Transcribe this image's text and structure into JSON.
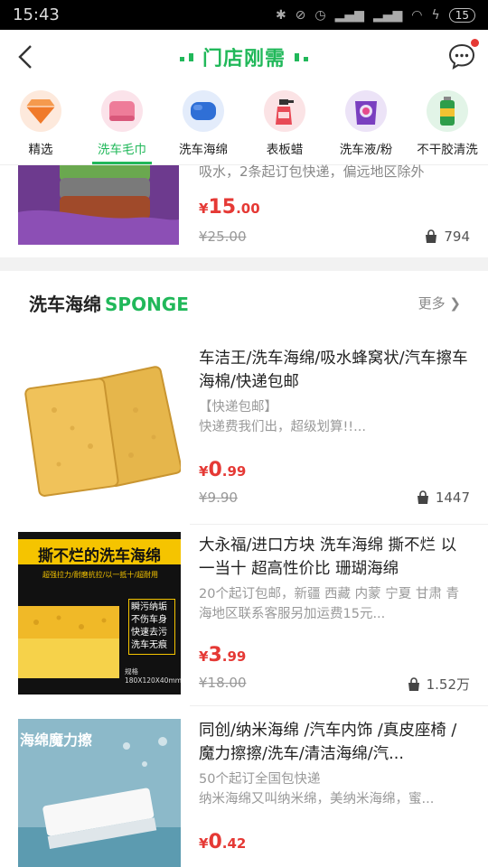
{
  "status_bar": {
    "time": "15:43",
    "battery": "15"
  },
  "header": {
    "title": "门店刚需"
  },
  "categories": [
    {
      "label": "精选",
      "icon": "diamond-icon"
    },
    {
      "label": "洗车毛巾",
      "icon": "towel-icon",
      "active": true
    },
    {
      "label": "洗车海绵",
      "icon": "sponge-icon"
    },
    {
      "label": "表板蜡",
      "icon": "spray-bottle-icon"
    },
    {
      "label": "洗车液/粉",
      "icon": "detergent-icon"
    },
    {
      "label": "不干胶清洗",
      "icon": "cleaner-can-icon"
    }
  ],
  "top_product": {
    "desc": "吸水，2条起订包快递，偏远地区除外",
    "price_symbol": "¥",
    "price_int": "15",
    "price_dec": ".00",
    "old_price": "¥25.00",
    "sales": "794"
  },
  "section": {
    "title": "洗车海绵",
    "title_en": "SPONGE",
    "more": "更多"
  },
  "products": [
    {
      "name": "车洁王/洗车海绵/吸水蜂窝状/汽车擦车海棉/快递包邮",
      "tag": "【快递包邮】",
      "note": "快递费我们出，超级划算!!...",
      "price_symbol": "¥",
      "price_int": "0",
      "price_dec": ".99",
      "old_price": "¥9.90",
      "sales": "1447"
    },
    {
      "name": "大永福/进口方块 洗车海绵 撕不烂 以一当十 超高性价比 珊瑚海绵",
      "tag": "20个起订包邮，新疆 西藏 内蒙 宁夏 甘肃 青海地区联系客服另加运费15元...",
      "note": "",
      "price_symbol": "¥",
      "price_int": "3",
      "price_dec": ".99",
      "old_price": "¥18.00",
      "sales": "1.52万",
      "image_text": "撕不烂的洗车海绵",
      "image_sub": "超强拉力/耐磨抗拉/以一抵十/超耐用",
      "image_side": "瞬污纳垢 不伤车身 快速去污 洗车无痕",
      "image_spec": "规格 180X120X40mm"
    },
    {
      "name": "同创/纳米海绵 /汽车内饰 /真皮座椅 /魔力擦擦/洗车/清洁海绵/汽...",
      "tag": "50个起订全国包快递",
      "note": "纳米海绵又叫纳米绵，美纳米海绵，蜜...",
      "price_symbol": "¥",
      "price_int": "0",
      "price_dec": ".42",
      "old_price": "",
      "sales": "",
      "image_text": "海绵魔力擦"
    }
  ],
  "colors": {
    "brand_green": "#21b85a",
    "price_red": "#e53935"
  }
}
